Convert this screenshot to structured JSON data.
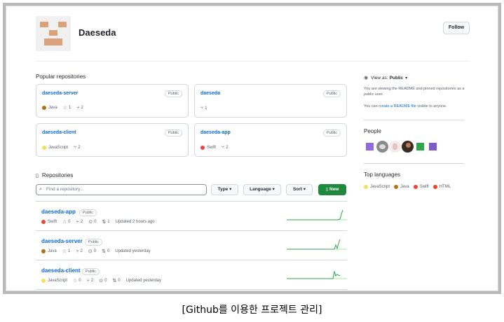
{
  "profile": {
    "username": "Daeseda",
    "follow_label": "Follow"
  },
  "popular": {
    "title": "Popular repositories",
    "cards": [
      {
        "name": "daeseda-server",
        "badge": "Public",
        "language": "Java",
        "lang_color": "#b07219",
        "stars": "1",
        "forks": "2"
      },
      {
        "name": "daeseda",
        "badge": "Public",
        "forks": "1"
      },
      {
        "name": "daeseda-client",
        "badge": "Public",
        "language": "JavaScript",
        "lang_color": "#f1e05a",
        "forks": "2"
      },
      {
        "name": "daeseda-app",
        "badge": "Public",
        "language": "Swift",
        "lang_color": "#e9473b",
        "forks": "2"
      }
    ]
  },
  "repos": {
    "title": "Repositories",
    "search_placeholder": "Find a repository...",
    "type_label": "Type",
    "language_label": "Language",
    "sort_label": "Sort",
    "new_label": "New",
    "rows": [
      {
        "name": "daeseda-app",
        "badge": "Public",
        "language": "Swift",
        "lang_color": "#e9473b",
        "stars": "0",
        "forks": "2",
        "issues": "0",
        "prs": "1",
        "updated": "Updated 2 hours ago"
      },
      {
        "name": "daeseda-server",
        "badge": "Public",
        "language": "Java",
        "lang_color": "#b07219",
        "stars": "1",
        "forks": "2",
        "issues": "0",
        "prs": "0",
        "updated": "Updated yesterday"
      },
      {
        "name": "daeseda-client",
        "badge": "Public",
        "language": "JavaScript",
        "lang_color": "#f1e05a",
        "stars": "0",
        "forks": "2",
        "issues": "0",
        "prs": "0",
        "updated": "Updated yesterday"
      }
    ]
  },
  "sidebar": {
    "view_as_label": "View as:",
    "view_as_value": "Public",
    "view_text": "You are viewing the README and pinned repositories as a public user.",
    "create_prefix": "You can ",
    "create_link": "create a README file",
    "create_suffix": " visible to anyone.",
    "people_title": "People",
    "people_colors": [
      "#8f6ad8",
      "#6d6d6d",
      "#f2d6d6",
      "#3a2a24",
      "#2ea44f",
      "#7b5cc8"
    ],
    "languages_title": "Top languages",
    "languages": [
      {
        "name": "JavaScript",
        "color": "#f1e05a"
      },
      {
        "name": "Java",
        "color": "#b07219"
      },
      {
        "name": "Swift",
        "color": "#e9473b"
      },
      {
        "name": "HTML",
        "color": "#e34c26"
      }
    ]
  },
  "caption": "[Github를 이용한 프로젝트 관리]"
}
